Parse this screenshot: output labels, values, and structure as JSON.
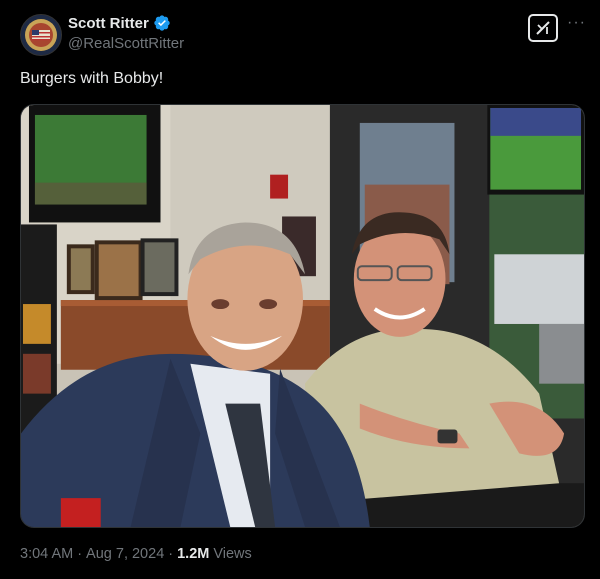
{
  "post": {
    "author": {
      "display_name": "Scott Ritter",
      "handle": "@RealScottRitter",
      "verified": true,
      "avatar_icon": "avatar-badge"
    },
    "text": "Burgers with Bobby!",
    "media": {
      "type": "photo",
      "alt": ""
    },
    "meta": {
      "time": "3:04 AM",
      "separator": "·",
      "date": "Aug 7, 2024",
      "views_count": "1.2M",
      "views_label": "Views"
    },
    "actions": {
      "grok_icon": "grok-icon",
      "more_icon": "more-icon",
      "more_glyph": "···"
    }
  },
  "colors": {
    "background": "#000000",
    "text_primary": "#e7e9ea",
    "text_secondary": "#71767b",
    "verified_blue": "#1d9bf0"
  }
}
